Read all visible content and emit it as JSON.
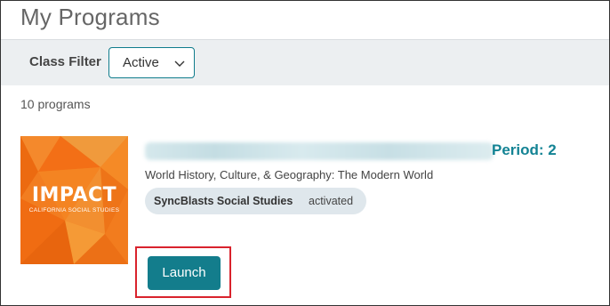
{
  "header": {
    "title": "My Programs"
  },
  "filter": {
    "label": "Class Filter",
    "selected": "Active",
    "accent": "#0f7c8c"
  },
  "summary": {
    "count_text": "10 programs"
  },
  "program": {
    "cover_title": "IMPACT",
    "cover_subtitle": "CALIFORNIA SOCIAL STUDIES",
    "name_redacted": "",
    "period_text": "Period: 2",
    "subject": "World History, Culture, & Geography: The Modern World",
    "product_name": "SyncBlasts Social Studies",
    "product_status": "activated",
    "launch_label": "Launch"
  },
  "colors": {
    "teal": "#137d8c",
    "highlight": "#d9232d",
    "cover_orange": "#f27a1a"
  },
  "icons": {
    "filter_dropdown": "chevron-down-icon"
  }
}
